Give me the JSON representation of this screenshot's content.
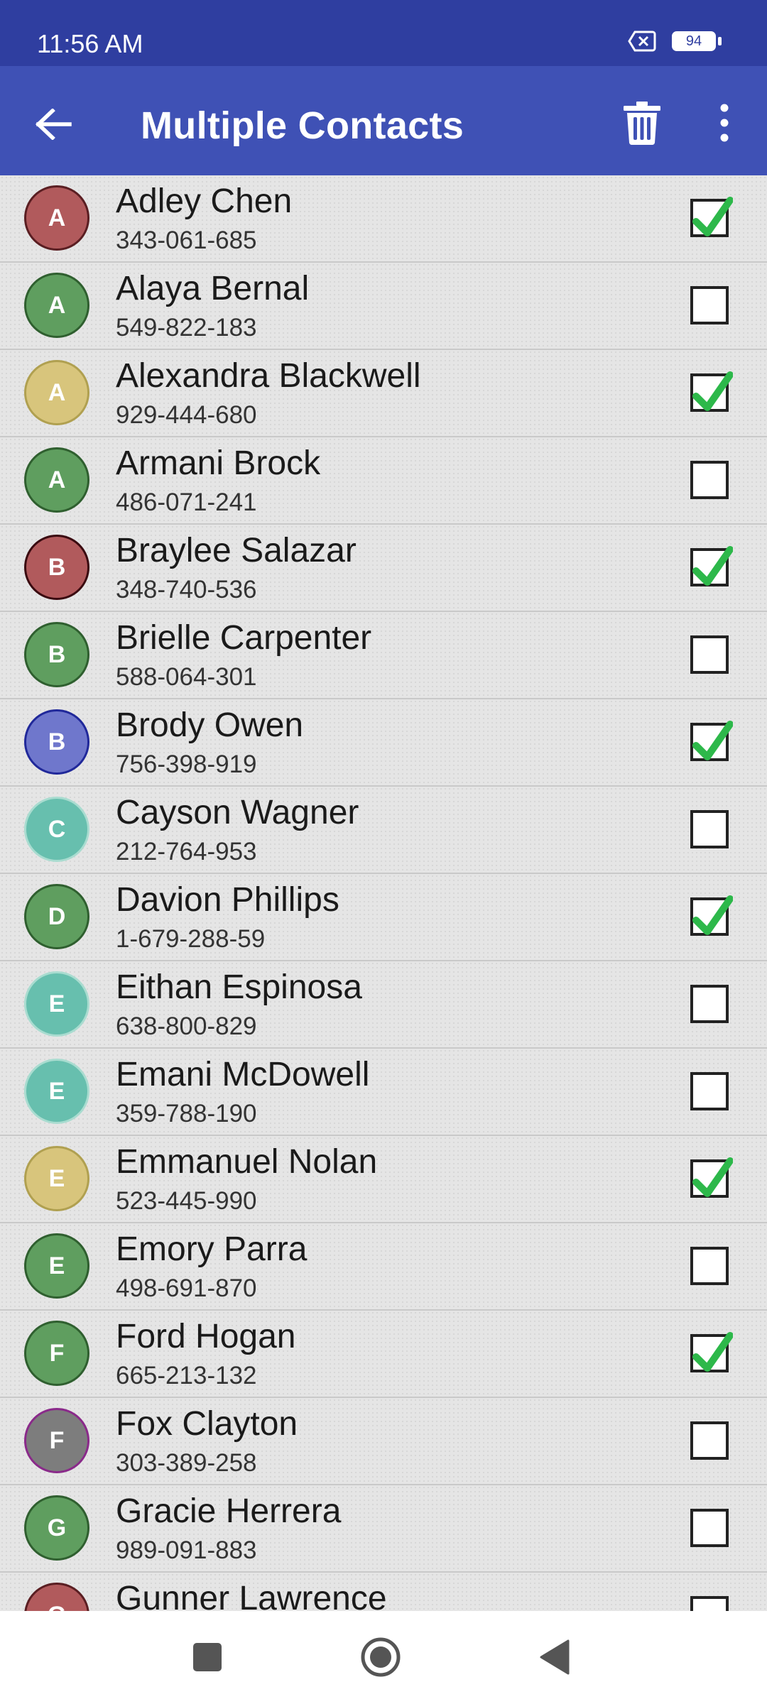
{
  "status_bar": {
    "time": "11:56 AM",
    "battery_level": "94",
    "icons": [
      "sim-off-icon",
      "battery-icon"
    ]
  },
  "app_bar": {
    "title": "Multiple Contacts",
    "icons": [
      "back-arrow-icon",
      "trash-icon",
      "more-vert-icon"
    ]
  },
  "colors": {
    "status_bar": "#2f3ea0",
    "app_bar": "#3f51b5",
    "check_mark": "#2db84a"
  },
  "contacts": [
    {
      "initial": "A",
      "name": "Adley Chen",
      "phone": "343-061-685",
      "checked": true,
      "avatar_color": "#b15a5c",
      "border_color": "#5a1e22"
    },
    {
      "initial": "A",
      "name": "Alaya Bernal",
      "phone": "549-822-183",
      "checked": false,
      "avatar_color": "#5f9e5f",
      "border_color": "#2f5f2f"
    },
    {
      "initial": "A",
      "name": "Alexandra Blackwell",
      "phone": "929-444-680",
      "checked": true,
      "avatar_color": "#d8c57c",
      "border_color": "#b0a050"
    },
    {
      "initial": "A",
      "name": "Armani Brock",
      "phone": "486-071-241",
      "checked": false,
      "avatar_color": "#5f9e5f",
      "border_color": "#2f5f2f"
    },
    {
      "initial": "B",
      "name": "Braylee Salazar",
      "phone": "348-740-536",
      "checked": true,
      "avatar_color": "#b15a5c",
      "border_color": "#3a0a10"
    },
    {
      "initial": "B",
      "name": "Brielle Carpenter",
      "phone": "588-064-301",
      "checked": false,
      "avatar_color": "#5f9e5f",
      "border_color": "#2f5f2f"
    },
    {
      "initial": "B",
      "name": "Brody Owen",
      "phone": "756-398-919",
      "checked": true,
      "avatar_color": "#6f77cc",
      "border_color": "#20289a"
    },
    {
      "initial": "C",
      "name": "Cayson Wagner",
      "phone": "212-764-953",
      "checked": false,
      "avatar_color": "#67bfae",
      "border_color": "#a9dcd0"
    },
    {
      "initial": "D",
      "name": "Davion Phillips",
      "phone": "1-679-288-59",
      "checked": true,
      "avatar_color": "#5f9e5f",
      "border_color": "#2f5f2f"
    },
    {
      "initial": "E",
      "name": "Eithan Espinosa",
      "phone": "638-800-829",
      "checked": false,
      "avatar_color": "#67bfae",
      "border_color": "#a9dcd0"
    },
    {
      "initial": "E",
      "name": "Emani McDowell",
      "phone": "359-788-190",
      "checked": false,
      "avatar_color": "#67bfae",
      "border_color": "#a9dcd0"
    },
    {
      "initial": "E",
      "name": "Emmanuel Nolan",
      "phone": "523-445-990",
      "checked": true,
      "avatar_color": "#d8c57c",
      "border_color": "#b0a050"
    },
    {
      "initial": "E",
      "name": "Emory Parra",
      "phone": "498-691-870",
      "checked": false,
      "avatar_color": "#5f9e5f",
      "border_color": "#2f5f2f"
    },
    {
      "initial": "F",
      "name": "Ford Hogan",
      "phone": "665-213-132",
      "checked": true,
      "avatar_color": "#5f9e5f",
      "border_color": "#2f5f2f"
    },
    {
      "initial": "F",
      "name": "Fox Clayton",
      "phone": "303-389-258",
      "checked": false,
      "avatar_color": "#7d7d7d",
      "border_color": "#8a2a8a"
    },
    {
      "initial": "G",
      "name": "Gracie Herrera",
      "phone": "989-091-883",
      "checked": false,
      "avatar_color": "#5f9e5f",
      "border_color": "#2f5f2f"
    },
    {
      "initial": "G",
      "name": "Gunner Lawrence",
      "phone": "",
      "checked": false,
      "avatar_color": "#b15a5c",
      "border_color": "#5a1e22"
    }
  ],
  "nav_bar": {
    "icons": [
      "recents-square-icon",
      "home-circle-icon",
      "back-triangle-icon"
    ]
  }
}
